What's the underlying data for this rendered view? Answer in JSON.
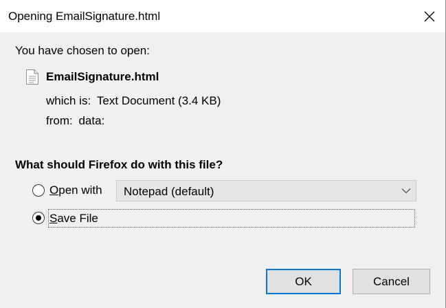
{
  "window": {
    "title": "Opening EmailSignature.html"
  },
  "intro_text": "You have chosen to open:",
  "file": {
    "icon": "text-document-icon",
    "name": "EmailSignature.html",
    "type_label": "which is:",
    "type_value": "Text Document (3.4 KB)",
    "from_label": "from:",
    "from_value": "data:"
  },
  "question": "What should Firefox do with this file?",
  "options": {
    "open_with": {
      "access_key": "O",
      "label_rest": "pen with",
      "selected": false,
      "app_value": "Notepad (default)"
    },
    "save_file": {
      "access_key": "S",
      "label_rest": "ave File",
      "selected": true
    }
  },
  "buttons": {
    "ok": "OK",
    "cancel": "Cancel"
  },
  "colors": {
    "focus_border": "#0078d7",
    "dialog_bg": "#f0f0f0",
    "titlebar_bg": "#ffffff"
  }
}
